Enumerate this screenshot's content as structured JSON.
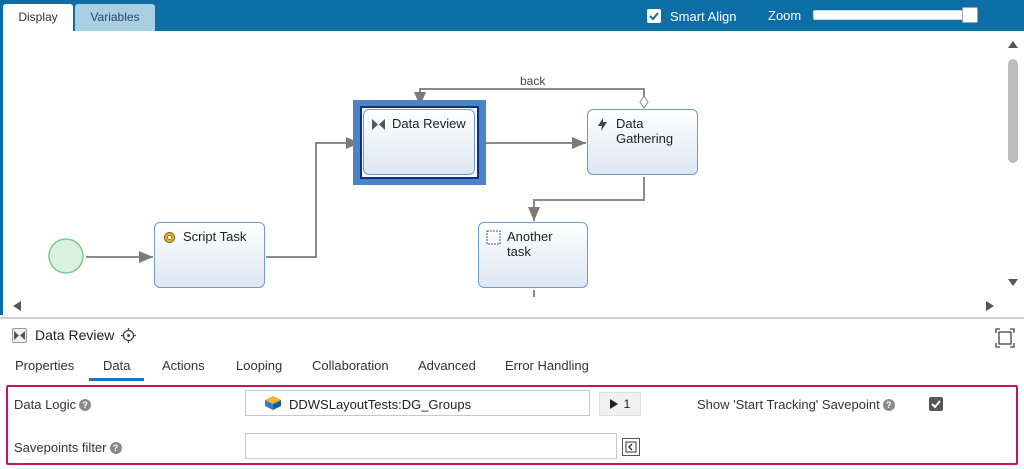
{
  "tabs": {
    "display": "Display",
    "variables": "Variables"
  },
  "toolbar": {
    "smart_align": "Smart Align",
    "zoom": "Zoom",
    "smart_align_checked": true,
    "zoom_level": 0.93
  },
  "diagram": {
    "flow_label_back": "back",
    "tasks": {
      "script": "Script Task",
      "data_review": "Data Review",
      "data_gathering_1": "Data",
      "data_gathering_2": "Gathering",
      "another_1": "Another",
      "another_2": "task"
    }
  },
  "panel": {
    "title": "Data Review",
    "subtabs": [
      "Properties",
      "Data",
      "Actions",
      "Looping",
      "Collaboration",
      "Advanced",
      "Error Handling"
    ],
    "active_subtab": "Data"
  },
  "form": {
    "data_logic_label": "Data Logic",
    "data_logic_value": "DDWSLayoutTests:DG_Groups",
    "run_count": "1",
    "show_tracking_label": "Show 'Start Tracking' Savepoint",
    "show_tracking_checked": true,
    "savepoints_label": "Savepoints filter",
    "savepoints_value": ""
  },
  "colors": {
    "header": "#0d6ea6",
    "selection": "#4a84c7",
    "form_border": "#c2185b"
  }
}
